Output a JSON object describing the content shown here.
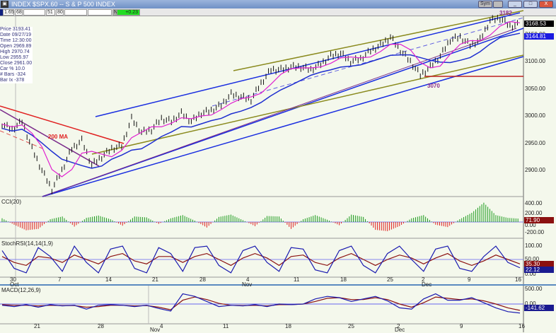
{
  "window": {
    "title": "INDEX $SPX.60 -- S & P 500 INDEX",
    "sym_label": "Sym",
    "buttons": [
      "_",
      "□",
      "X"
    ]
  },
  "toolbar": {
    "fields": [
      "1.65",
      "68",
      "",
      "51",
      "80",
      "",
      ""
    ],
    "flag": "N",
    "change": "+0.23"
  },
  "info": [
    [
      "Price",
      "3193.41"
    ],
    [
      "Date",
      "09/27/19"
    ],
    [
      "Time",
      "12:30:00"
    ],
    [
      "Open",
      "2969.89"
    ],
    [
      "High",
      "2970.74"
    ],
    [
      "Low",
      "2955.97"
    ],
    [
      "Close",
      "2961.00"
    ],
    [
      "Car %",
      "10.0"
    ],
    [
      "# Bars",
      "-324"
    ],
    [
      "Bar Ix",
      "-378"
    ]
  ],
  "colors": {
    "price_bars": "#111111",
    "ma_blue": "#1f2fd0",
    "ma_magenta": "#e020d0",
    "channel_blue": "#1a2ee0",
    "channel_olive": "#8a8a1e",
    "red": "#e02020",
    "purple": "#7a2a8a",
    "indicator_main": "#1a1ab0",
    "indicator_signal": "#8b1010"
  },
  "price_panel": {
    "axis_labels": [
      "3150.00",
      "3100.00",
      "3050.00",
      "3000.00",
      "2950.00",
      "2900.00"
    ],
    "last_price": "3168.53",
    "ma_value": "3144.81",
    "annotations": {
      "high": "3182",
      "low": "3070",
      "ma": "200 MA"
    }
  },
  "cci_panel": {
    "label": "CCI(20)",
    "axis_labels": [
      "400.00",
      "200.00",
      "0.00",
      "-200.00"
    ],
    "value": "71.90"
  },
  "stoch_panel": {
    "label": "StochRSI(14,14(1,9)",
    "axis_labels": [
      "100.00",
      "50.00",
      "0.00"
    ],
    "value_signal": "35.30",
    "value_main": "22.12"
  },
  "macd_panel": {
    "label": "MACD(12,26,9)",
    "axis_labels": [
      "500.00",
      "0.00"
    ],
    "value": "-141.62"
  },
  "date_axis_top": {
    "days": [
      "30",
      "7",
      "14",
      "21",
      "28",
      "4",
      "11",
      "18",
      "25",
      "2",
      "9",
      "16"
    ],
    "months": [
      "Oct",
      "Nov",
      "Dec"
    ]
  },
  "date_axis_bottom": {
    "days": [
      "21",
      "28",
      "4",
      "11",
      "18",
      "25",
      "2",
      "9",
      "16"
    ],
    "months": [
      "Nov",
      "Dec"
    ]
  },
  "chart_data": {
    "type": "line",
    "title": "INDEX $SPX.60 -- S & P 500 INDEX",
    "ylim": [
      2850,
      3190
    ],
    "closes": [
      2985,
      2975,
      2990,
      2940,
      2900,
      2865,
      2900,
      2940,
      2955,
      2910,
      2925,
      2940,
      2945,
      2995,
      2970,
      2975,
      2995,
      2990,
      3005,
      2990,
      3005,
      3010,
      3020,
      3040,
      3035,
      3030,
      3060,
      3085,
      3085,
      3090,
      3090,
      3085,
      3095,
      3110,
      3115,
      3100,
      3105,
      3120,
      3130,
      3145,
      3120,
      3100,
      3075,
      3090,
      3110,
      3140,
      3145,
      3130,
      3140,
      3175,
      3180,
      3165,
      3168
    ],
    "cci": [
      80,
      -60,
      -180,
      -150,
      60,
      120,
      -100,
      90,
      140,
      60,
      -80,
      120,
      100,
      -40,
      80,
      150,
      30,
      -120,
      110,
      160,
      40,
      -90,
      130,
      120,
      -150,
      60,
      150,
      50,
      -70,
      160,
      110,
      -170,
      -200,
      -90,
      80,
      150,
      -60,
      -110,
      60,
      200,
      420,
      150,
      90,
      72
    ],
    "stoch_rsi": [
      80,
      20,
      5,
      90,
      60,
      10,
      95,
      40,
      5,
      85,
      95,
      20,
      5,
      90,
      70,
      10,
      90,
      95,
      30,
      5,
      80,
      95,
      40,
      10,
      90,
      85,
      15,
      5,
      80,
      95,
      30,
      5,
      70,
      95,
      50,
      10,
      85,
      95,
      20,
      10,
      60,
      95,
      40,
      22
    ],
    "stoch_signal": [
      60,
      40,
      30,
      60,
      55,
      40,
      65,
      50,
      35,
      60,
      70,
      45,
      35,
      60,
      60,
      40,
      60,
      70,
      50,
      30,
      55,
      70,
      55,
      30,
      60,
      65,
      40,
      30,
      55,
      70,
      50,
      30,
      50,
      65,
      55,
      35,
      55,
      70,
      45,
      30,
      45,
      65,
      50,
      35
    ],
    "macd": [
      -20,
      -40,
      -10,
      -50,
      -10,
      -30,
      -20,
      -80,
      -20,
      -10,
      -20,
      -40,
      -20,
      -70,
      -110,
      160,
      120,
      40,
      -40,
      -20,
      -30,
      -10,
      -40,
      0,
      -10,
      0,
      80,
      120,
      100,
      40,
      80,
      120,
      50,
      -60,
      -80,
      80,
      160,
      60,
      60,
      100,
      20,
      -60,
      -120,
      -142
    ],
    "macd_signal": [
      -10,
      -20,
      -20,
      -30,
      -20,
      -25,
      -25,
      -50,
      -40,
      -20,
      -20,
      -30,
      -25,
      -50,
      -90,
      60,
      110,
      70,
      10,
      -20,
      -25,
      -20,
      -30,
      -10,
      -10,
      0,
      40,
      90,
      100,
      70,
      70,
      100,
      70,
      0,
      -50,
      20,
      110,
      90,
      70,
      80,
      50,
      0,
      -60,
      -100
    ]
  }
}
